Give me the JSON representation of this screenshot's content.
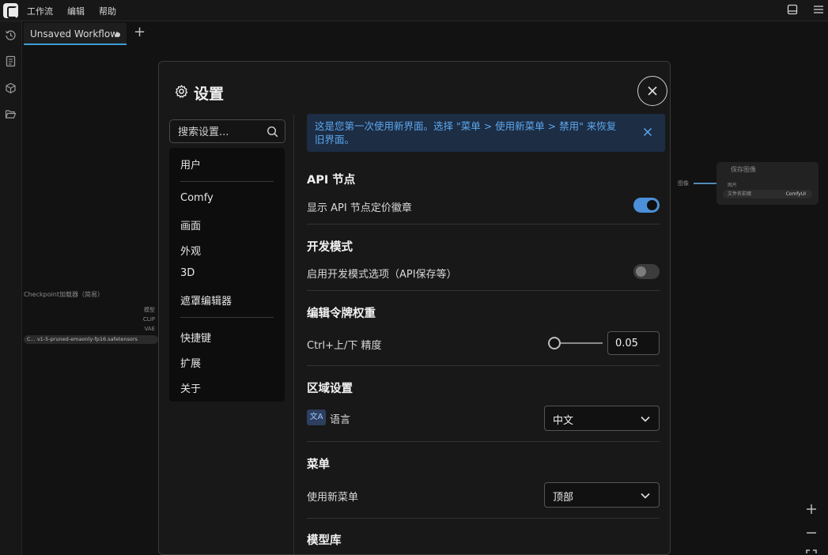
{
  "menubar": {
    "items": [
      "工作流",
      "编辑",
      "帮助"
    ]
  },
  "sidebar": {
    "icons": [
      "history-icon",
      "document-icon",
      "cube-icon",
      "folder-open-icon"
    ]
  },
  "tabs": [
    {
      "label": "Unsaved Workflow",
      "modified": true
    }
  ],
  "canvas": {
    "left_node": {
      "title": "Checkpoint加载器（简易）",
      "outputs": [
        "模型",
        "CLIP",
        "VAE"
      ],
      "ckpt_prefix": "C...",
      "ckpt_name": "v1-5-pruned-emaonly-fp16.safetensors"
    },
    "right_node": {
      "title": "保存图像",
      "input": "图片",
      "field_label": "文件名前缀",
      "field_value": "ComfyUI"
    },
    "image_label": "图像"
  },
  "dialog": {
    "title": "设置",
    "search_placeholder": "搜索设置...",
    "nav": {
      "group1": [
        "用户"
      ],
      "group2": [
        "Comfy",
        "画面",
        "外观",
        "3D",
        "遮罩编辑器"
      ],
      "group3": [
        "快捷键",
        "扩展",
        "关于"
      ]
    },
    "notice": "这是您第一次使用新界面。选择 \"菜单 > 使用新菜单 > 禁用\" 来恢复旧界面。",
    "sections": {
      "api": {
        "title": "API 节点",
        "setting": "显示 API 节点定价徽章",
        "enabled": true
      },
      "dev": {
        "title": "开发模式",
        "setting": "启用开发模式选项（API保存等）",
        "enabled": false
      },
      "token": {
        "title": "编辑令牌权重",
        "setting": "Ctrl+上/下 精度",
        "value": "0.05"
      },
      "locale": {
        "title": "区域设置",
        "setting": "语言",
        "value": "中文"
      },
      "menu": {
        "title": "菜单",
        "setting": "使用新菜单",
        "value": "顶部"
      },
      "next": {
        "title": "模型库"
      }
    }
  },
  "colors": {
    "accent": "#4b90d9",
    "notice_bg": "#1c2d44",
    "notice_text": "#5ea8ef"
  }
}
